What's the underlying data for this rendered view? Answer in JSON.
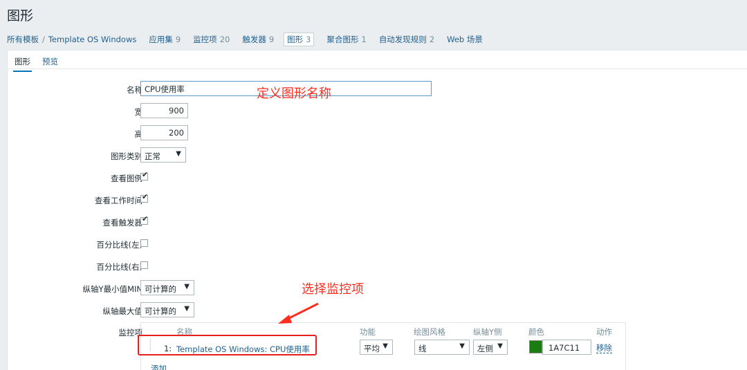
{
  "page": {
    "title": "图形"
  },
  "nav": {
    "all_templates": "所有模板",
    "separator": "/",
    "template": "Template OS Windows",
    "items": [
      {
        "label": "应用集",
        "count": "9"
      },
      {
        "label": "监控项",
        "count": "20"
      },
      {
        "label": "触发器",
        "count": "9"
      },
      {
        "label": "图形",
        "count": "3"
      },
      {
        "label": "聚合图形",
        "count": "1"
      },
      {
        "label": "自动发现规则",
        "count": "2"
      },
      {
        "label": "Web 场景",
        "count": ""
      }
    ]
  },
  "tabs": {
    "graph": "图形",
    "preview": "预览"
  },
  "form": {
    "name_label": "名称",
    "name_value": "CPU使用率",
    "width_label": "宽",
    "width_value": "900",
    "height_label": "高",
    "height_value": "200",
    "type_label": "图形类别",
    "type_value": "正常",
    "show_legend_label": "查看图例",
    "show_legend": true,
    "show_working_time_label": "查看工作时间",
    "show_working_time": true,
    "show_triggers_label": "查看触发器",
    "show_triggers": true,
    "percentile_left_label": "百分比线(左)",
    "percentile_left": false,
    "percentile_right_label": "百分比线(右)",
    "percentile_right": false,
    "ymin_label": "纵轴Y最小值MIN",
    "ymin_value": "可计算的",
    "ymax_label": "纵轴最大值",
    "ymax_value": "可计算的",
    "items_label": "监控项"
  },
  "items_table": {
    "headers": {
      "name": "名称",
      "function": "功能",
      "draw_style": "绘图风格",
      "y_axis": "纵轴Y侧",
      "color": "颜色",
      "action": "动作"
    },
    "rows": [
      {
        "index": "1:",
        "name": "Template OS Windows: CPU使用率",
        "function": "平均",
        "draw_style": "线",
        "y_axis": "左侧",
        "color": "1A7C11",
        "action": "移除"
      }
    ],
    "add": "添加"
  },
  "annotations": {
    "name": "定义图形名称",
    "items": "选择监控项"
  },
  "colors": {
    "annotation": "#ff2d1f",
    "accent": "#0275b8",
    "item_color": "#1a7c11"
  }
}
